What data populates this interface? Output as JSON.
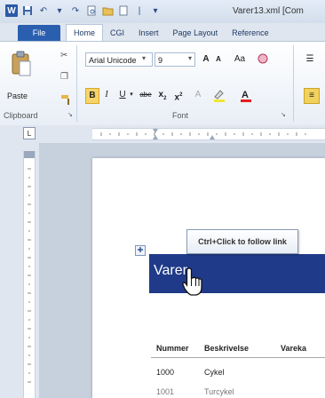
{
  "titlebar": {
    "title": "Varer13.xml [Com",
    "qat_icons": [
      "word-logo-icon",
      "save-icon",
      "undo-icon",
      "redo-icon",
      "print-preview-icon",
      "open-icon",
      "new-icon",
      "customize-qat-icon"
    ]
  },
  "tabs": [
    {
      "label": "File"
    },
    {
      "label": "Home"
    },
    {
      "label": "CGI"
    },
    {
      "label": "Insert"
    },
    {
      "label": "Page Layout"
    },
    {
      "label": "Reference"
    }
  ],
  "ribbon": {
    "clipboard": {
      "paste_label": "Paste",
      "group_label": "Clipboard"
    },
    "font": {
      "font_name": "Arial Unicode",
      "font_size": "9",
      "group_label": "Font",
      "grow_font": "A",
      "shrink_font": "A",
      "change_case": "Aa",
      "bold": "B",
      "italic": "I",
      "underline": "U",
      "strikethrough": "abe",
      "subscript": "x",
      "superscript": "x"
    }
  },
  "document": {
    "heading": "Varer",
    "tooltip": "Ctrl+Click to follow link",
    "table": {
      "headers": [
        "Nummer",
        "Beskrivelse",
        "Vareka"
      ],
      "rows": [
        [
          "1000",
          "Cykel"
        ],
        [
          "1001",
          "Turcykel"
        ]
      ]
    }
  },
  "colors": {
    "file_tab": "#2a5fb0",
    "banner": "#1f3a88",
    "bold_highlight": "#f6d46a"
  }
}
